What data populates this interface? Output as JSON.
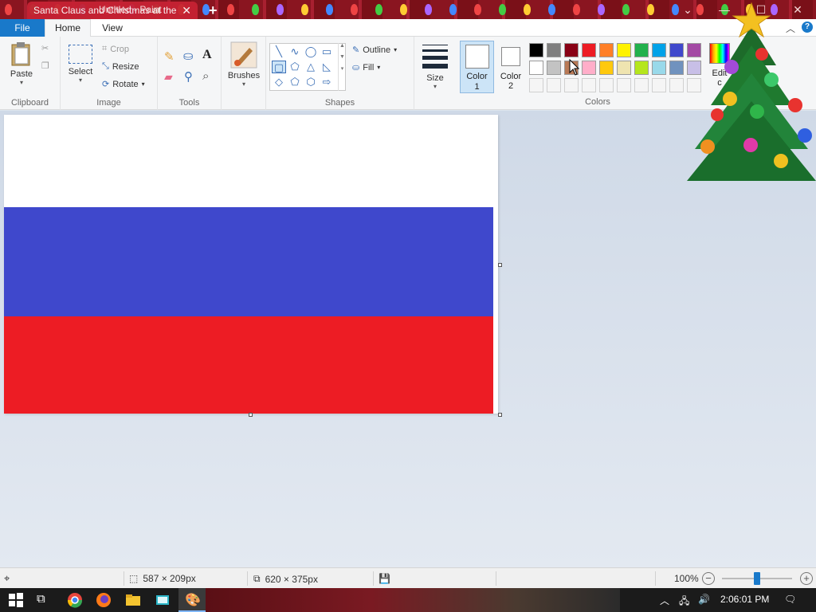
{
  "window": {
    "browser_tab_title": "Santa Claus and Christmas at the",
    "paint_title": "Untitled - Paint"
  },
  "menu": {
    "file": "File",
    "home": "Home",
    "view": "View"
  },
  "ribbon": {
    "clipboard": {
      "paste": "Paste",
      "label": "Clipboard"
    },
    "image": {
      "select": "Select",
      "crop": "Crop",
      "resize": "Resize",
      "rotate": "Rotate",
      "label": "Image"
    },
    "tools": {
      "label": "Tools"
    },
    "brushes": {
      "label": "Brushes"
    },
    "shapes": {
      "outline": "Outline",
      "fill": "Fill",
      "label": "Shapes"
    },
    "size": {
      "label": "Size"
    },
    "color1": {
      "line1": "Color",
      "line2": "1"
    },
    "color2": {
      "line1": "Color",
      "line2": "2"
    },
    "colors": {
      "label": "Colors",
      "edit_line1": "Edit",
      "edit_line2": "c"
    }
  },
  "palette": {
    "row1": [
      "#000000",
      "#7f7f7f",
      "#880015",
      "#ed1c24",
      "#ff7f27",
      "#fff200",
      "#22b14c",
      "#00a2e8",
      "#3f48cc",
      "#a349a4"
    ],
    "row2": [
      "#ffffff",
      "#c3c3c3",
      "#b97a57",
      "#ffaec9",
      "#ffc90e",
      "#efe4b0",
      "#b5e61d",
      "#99d9ea",
      "#7092be",
      "#c8bfe7"
    ],
    "row3": [
      "#f5f5f5",
      "#f5f5f5",
      "#f5f5f5",
      "#f5f5f5",
      "#f5f5f5",
      "#f5f5f5",
      "#f5f5f5",
      "#f5f5f5",
      "#f5f5f5",
      "#f5f5f5"
    ]
  },
  "canvas": {
    "stripes": [
      "#ffffff",
      "#3f48cc",
      "#ed1c24"
    ]
  },
  "status": {
    "selection_size": "587 × 209px",
    "canvas_size": "620 × 375px",
    "zoom": "100%"
  },
  "taskbar": {
    "time": "2:06:01 PM"
  }
}
